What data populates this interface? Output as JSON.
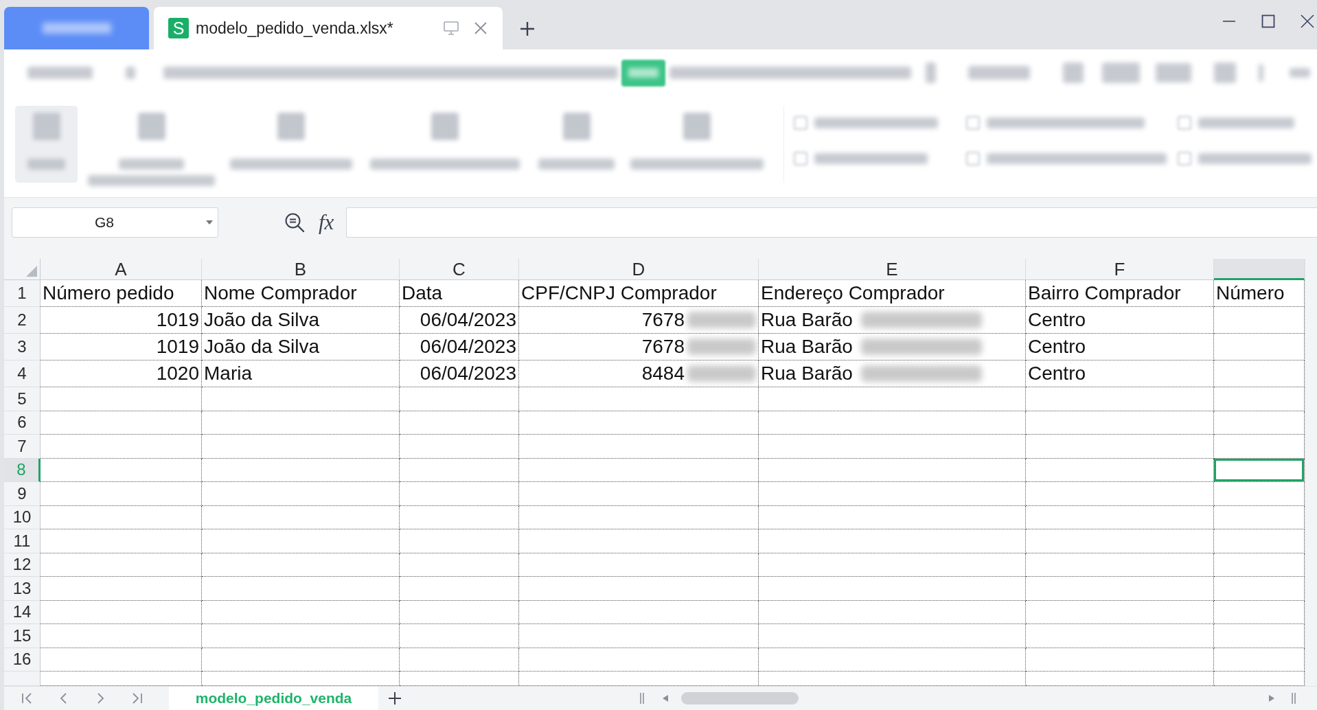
{
  "title_bar": {
    "document_tab": {
      "icon_letter": "S",
      "title": "modelo_pedido_venda.xlsx*"
    }
  },
  "formula_bar": {
    "name_box": "G8",
    "function_label": "fx"
  },
  "sheet": {
    "columns": [
      {
        "letter": "A",
        "selected": false
      },
      {
        "letter": "B",
        "selected": false
      },
      {
        "letter": "C",
        "selected": false
      },
      {
        "letter": "D",
        "selected": false
      },
      {
        "letter": "E",
        "selected": false
      },
      {
        "letter": "F",
        "selected": false
      },
      {
        "selected": true
      }
    ],
    "rows": [
      {
        "number": "1",
        "selected": false,
        "cells": [
          {
            "text": "Número pedido",
            "kind": "text",
            "redacted": false
          },
          {
            "text": "Nome Comprador",
            "kind": "text",
            "redacted": false
          },
          {
            "text": "Data",
            "kind": "text",
            "redacted": false
          },
          {
            "text": "CPF/CNPJ Comprador",
            "kind": "text",
            "redacted": false
          },
          {
            "text": "Endereço Comprador",
            "kind": "text",
            "redacted": false
          },
          {
            "text": "Bairro Comprador",
            "kind": "text",
            "redacted": false
          },
          {
            "text": "Número",
            "kind": "text",
            "redacted": false
          }
        ]
      },
      {
        "number": "2",
        "selected": false,
        "cells": [
          {
            "text": "1019",
            "kind": "number",
            "redacted": false
          },
          {
            "text": "João da Silva",
            "kind": "text",
            "redacted": false
          },
          {
            "text": "06/04/2023",
            "kind": "number",
            "redacted": false
          },
          {
            "text": "7678",
            "kind": "number",
            "redacted": true
          },
          {
            "text": "Rua Barão",
            "kind": "text",
            "redacted": true
          },
          {
            "text": "Centro",
            "kind": "text",
            "redacted": false
          }
        ]
      },
      {
        "number": "3",
        "selected": false,
        "cells": [
          {
            "text": "1019",
            "kind": "number",
            "redacted": false
          },
          {
            "text": "João da Silva",
            "kind": "text",
            "redacted": false
          },
          {
            "text": "06/04/2023",
            "kind": "number",
            "redacted": false
          },
          {
            "text": "7678",
            "kind": "number",
            "redacted": true
          },
          {
            "text": "Rua Barão",
            "kind": "text",
            "redacted": true
          },
          {
            "text": "Centro",
            "kind": "text",
            "redacted": false
          }
        ]
      },
      {
        "number": "4",
        "selected": false,
        "cells": [
          {
            "text": "1020",
            "kind": "number",
            "redacted": false
          },
          {
            "text": "Maria",
            "kind": "text",
            "redacted": false
          },
          {
            "text": "06/04/2023",
            "kind": "number",
            "redacted": false
          },
          {
            "text": "8484",
            "kind": "number",
            "redacted": true
          },
          {
            "text": "Rua Barão",
            "kind": "text",
            "redacted": true
          },
          {
            "text": "Centro",
            "kind": "text",
            "redacted": false
          }
        ]
      },
      {
        "number": "5",
        "selected": false
      },
      {
        "number": "6",
        "selected": false
      },
      {
        "number": "7",
        "selected": false
      },
      {
        "number": "8",
        "selected": true
      },
      {
        "number": "9",
        "selected": false
      },
      {
        "number": "10",
        "selected": false
      },
      {
        "number": "11",
        "selected": false
      },
      {
        "number": "12",
        "selected": false
      },
      {
        "number": "13",
        "selected": false
      },
      {
        "number": "14",
        "selected": false
      },
      {
        "number": "15",
        "selected": false
      },
      {
        "number": "16",
        "selected": false
      }
    ]
  },
  "sheet_tabs": [
    {
      "name": "modelo_pedido_venda",
      "selected": true
    }
  ]
}
